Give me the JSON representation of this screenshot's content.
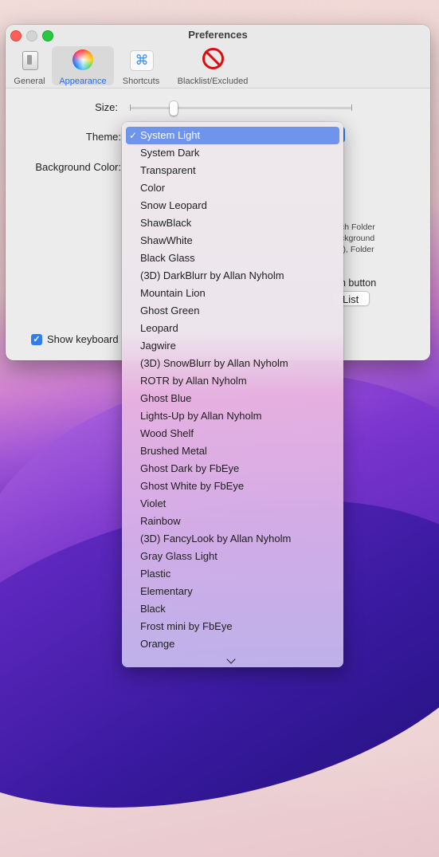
{
  "window": {
    "title": "Preferences"
  },
  "tabs": [
    {
      "label": "General",
      "icon": "general-switch-icon",
      "selected": false
    },
    {
      "label": "Appearance",
      "icon": "color-wheel-icon",
      "selected": true
    },
    {
      "label": "Shortcuts",
      "icon": "command-key-icon",
      "selected": false
    },
    {
      "label": "Blacklist/Excluded",
      "icon": "prohibited-icon",
      "selected": false
    }
  ],
  "settings": {
    "size_label": "Size:",
    "size_value": 0.2,
    "theme_label": "Theme:",
    "bg_color_label": "Background Color:",
    "desc_lines": [
      "ch  Folder",
      "ckground",
      "r),  Folder"
    ],
    "desc_line2": "h button",
    "list_button": "List",
    "show_keyboard_label": "Show keyboard",
    "show_keyboard_checked": true
  },
  "theme_menu": {
    "selected": "System Light",
    "check_glyph": "✓",
    "items": [
      "System Light",
      "System Dark",
      "Transparent",
      "Color",
      "Snow Leopard",
      "ShawBlack",
      "ShawWhite",
      "Black Glass",
      "(3D) DarkBlurr by Allan Nyholm",
      "Mountain Lion",
      "Ghost Green",
      "Leopard",
      "Jagwire",
      "(3D) SnowBlurr by Allan Nyholm",
      "ROTR by Allan Nyholm",
      "Ghost Blue",
      "Lights-Up by Allan Nyholm",
      "Wood Shelf",
      "Brushed Metal",
      "Ghost Dark by FbEye",
      "Ghost White by FbEye",
      "Violet",
      "Rainbow",
      "(3D) FancyLook by Allan Nyholm",
      "Gray Glass Light",
      "Plastic",
      "Elementary",
      "Black",
      "Frost mini by FbEye",
      "Orange"
    ],
    "scroll_indicator_icon": "chevron-down-icon"
  },
  "colors": {
    "accent": "#2e7ef0",
    "menu_highlight": "#6f94ec",
    "close": "#fe5f57",
    "zoom": "#28c840"
  }
}
